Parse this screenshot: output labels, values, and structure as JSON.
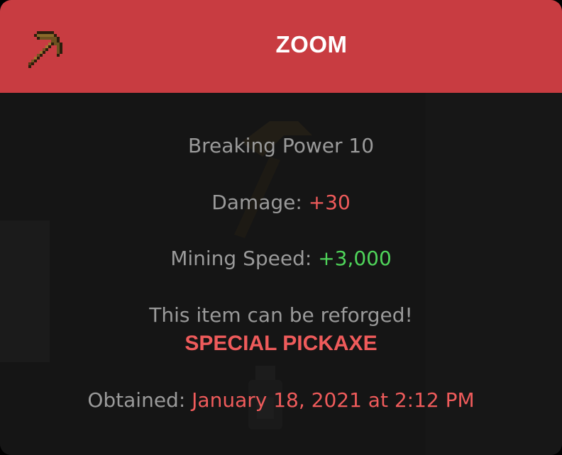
{
  "header": {
    "title": "ZOOM",
    "icon": "pickaxe-icon"
  },
  "stats": {
    "breaking_power": "Breaking Power 10",
    "damage_label": "Damage: ",
    "damage_value": "+30",
    "mining_speed_label": "Mining Speed: ",
    "mining_speed_value": "+3,000",
    "reforge_text": "This item can be reforged!",
    "rarity": "SPECIAL PICKAXE",
    "obtained_label": "Obtained: ",
    "obtained_value": "January 18, 2021 at 2:12 PM"
  },
  "colors": {
    "header_bg": "#c83c41",
    "body_bg": "#151515",
    "label": "#9a9a9a",
    "red_value": "#ef5b5b",
    "green_value": "#4fd45a"
  }
}
